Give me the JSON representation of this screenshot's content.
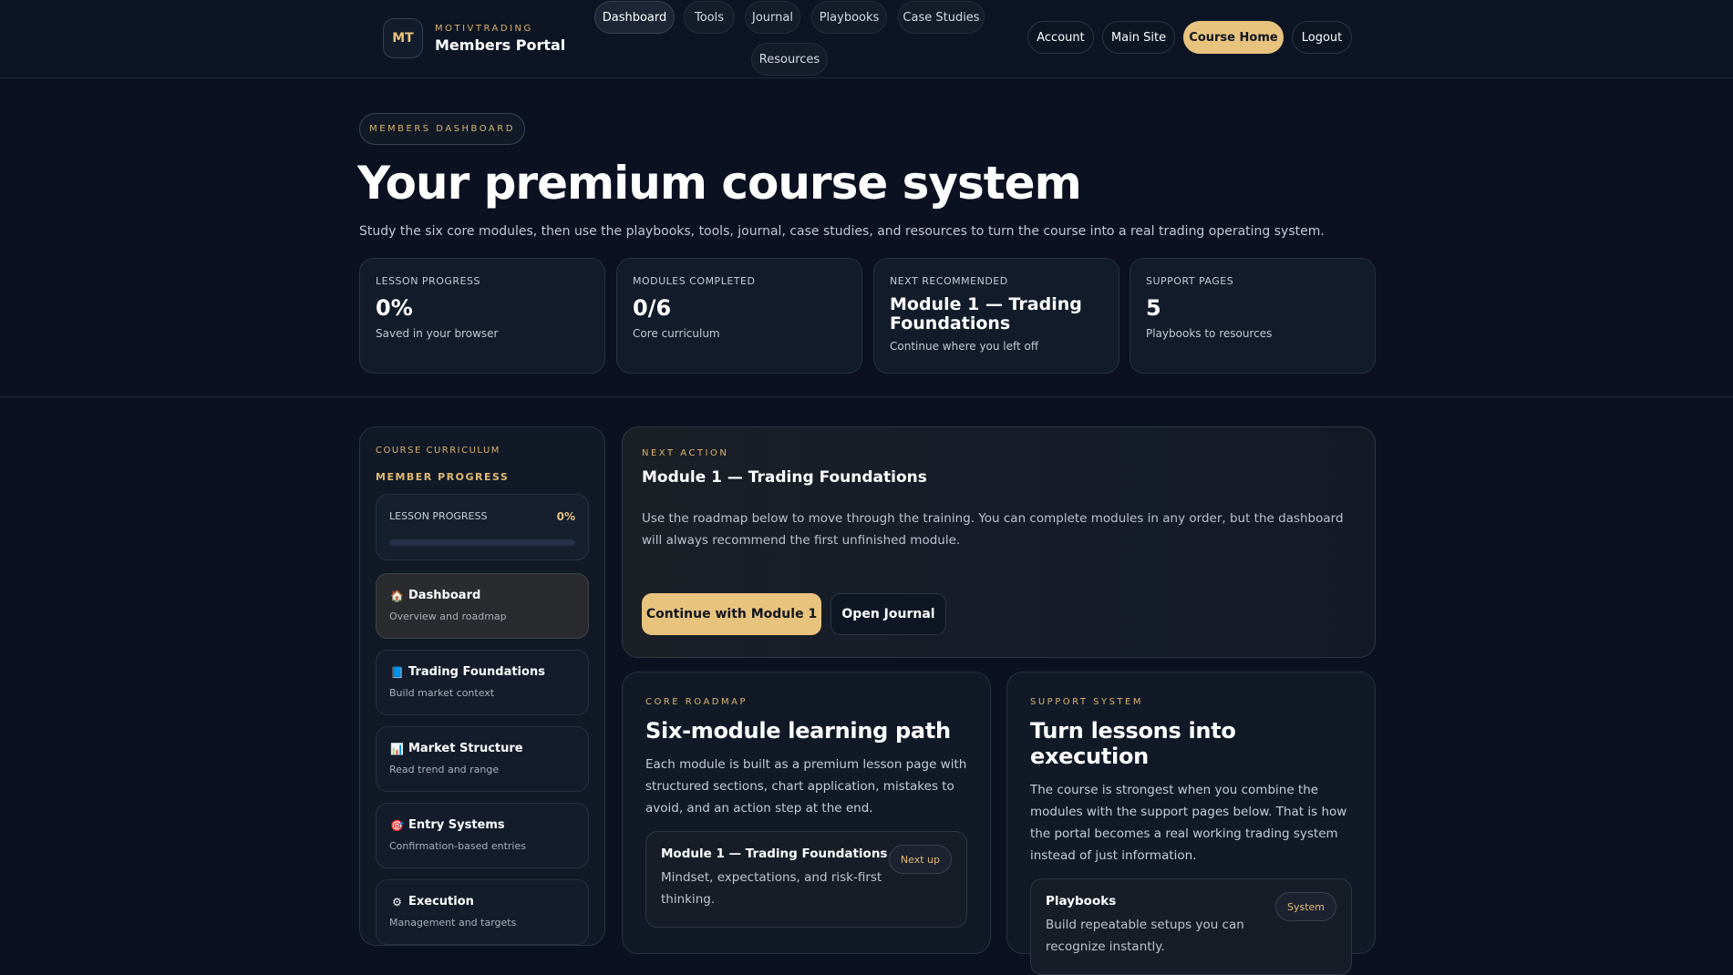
{
  "brand": {
    "badge": "MT",
    "kicker": "MOTIVTRADING",
    "name": "Members Portal"
  },
  "nav": {
    "links": [
      "Dashboard",
      "Tools",
      "Journal",
      "Playbooks",
      "Case Studies",
      "Resources"
    ],
    "account": "Account",
    "main_site": "Main Site",
    "course_home": "Course Home",
    "logout": "Logout"
  },
  "hero": {
    "label": "MEMBERS DASHBOARD",
    "title": "Your premium course system",
    "subtitle": "Study the six core modules, then use the playbooks, tools, journal, case studies, and resources to turn the course into a real trading operating system."
  },
  "stats": [
    {
      "label": "LESSON PROGRESS",
      "value": "0%",
      "note": "Saved in your browser"
    },
    {
      "label": "MODULES COMPLETED",
      "value": "0/6",
      "note": "Core curriculum"
    },
    {
      "label": "NEXT RECOMMENDED",
      "value": "Module 1 — Trading Foundations",
      "note": "Continue where you left off"
    },
    {
      "label": "SUPPORT PAGES",
      "value": "5",
      "note": "Playbooks to resources"
    }
  ],
  "sidebar": {
    "kicker": "COURSE CURRICULUM",
    "title": "MEMBER PROGRESS",
    "progress_label": "LESSON PROGRESS",
    "progress_value": "0%",
    "progress_fraction": 0,
    "items": [
      {
        "icon": "🏠",
        "title": "Dashboard",
        "sub": "Overview and roadmap"
      },
      {
        "icon": "📘",
        "title": "Trading Foundations",
        "sub": "Build market context"
      },
      {
        "icon": "📊",
        "title": "Market Structure",
        "sub": "Read trend and range"
      },
      {
        "icon": "🎯",
        "title": "Entry Systems",
        "sub": "Confirmation-based entries"
      },
      {
        "icon": "⚙",
        "title": "Execution",
        "sub": "Management and targets"
      }
    ]
  },
  "next_action": {
    "kicker": "NEXT ACTION",
    "title": "Module 1 — Trading Foundations",
    "description": "Use the roadmap below to move through the training. You can complete modules in any order, but the dashboard will always recommend the first unfinished module.",
    "primary_button": "Continue with Module 1",
    "secondary_button": "Open Journal"
  },
  "roadmap": {
    "kicker": "CORE ROADMAP",
    "title": "Six-module learning path",
    "description": "Each module is built as a premium lesson page with structured sections, chart application, mistakes to avoid, and an action step at the end.",
    "card_title": "Module 1 — Trading Foundations",
    "card_desc": "Mindset, expectations, and risk-first thinking.",
    "card_tag": "Next up"
  },
  "support": {
    "kicker": "SUPPORT SYSTEM",
    "title": "Turn lessons into execution",
    "description": "The course is strongest when you combine the modules with the support pages below. That is how the portal becomes a real working trading system instead of just information.",
    "card_title": "Playbooks",
    "card_desc": "Build repeatable setups you can recognize instantly.",
    "card_tag": "System"
  }
}
